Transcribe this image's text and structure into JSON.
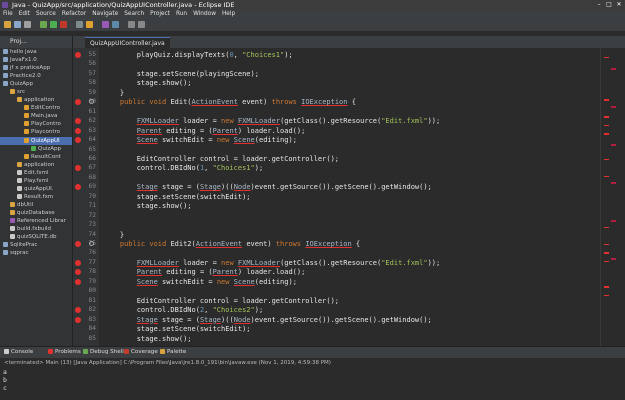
{
  "window": {
    "title": "Java - QuizApp/src/application/QuizAppUIController.java - Eclipse IDE"
  },
  "menu": [
    "File",
    "Edit",
    "Source",
    "Refactor",
    "Navigate",
    "Search",
    "Project",
    "Run",
    "Window",
    "Help"
  ],
  "sidebar": {
    "title": "Proj...",
    "items": [
      {
        "label": "hello java"
      },
      {
        "label": "JavaFx1.0"
      },
      {
        "label": "jf x praticeApp"
      },
      {
        "label": "Practice2.0"
      },
      {
        "label": "QuizApp"
      },
      {
        "label": "src"
      },
      {
        "label": "application"
      },
      {
        "label": "EditContro"
      },
      {
        "label": "Main.java"
      },
      {
        "label": "PlayContro"
      },
      {
        "label": "Playcontro"
      },
      {
        "label": "QuizAppUI"
      },
      {
        "label": "QuizApp"
      },
      {
        "label": "ResultCont"
      },
      {
        "label": "application"
      },
      {
        "label": "Edit.fxml"
      },
      {
        "label": "Play.fxml"
      },
      {
        "label": "quizAppUI."
      },
      {
        "label": "Result.fxm"
      },
      {
        "label": "dbUtil"
      },
      {
        "label": "quizDatabase"
      },
      {
        "label": "Referenced Librar"
      },
      {
        "label": "build.fxbuild"
      },
      {
        "label": "quizSQLITE.db"
      },
      {
        "label": "SqlitePrac"
      },
      {
        "label": "sqprac"
      }
    ]
  },
  "editor": {
    "tab": "QuizAppUIController.java",
    "lines": [
      {
        "n": "55",
        "text": "        playQuiz.displayTexts(0, \"Choices1\");",
        "err": true
      },
      {
        "n": "56",
        "text": ""
      },
      {
        "n": "57",
        "text": "        stage.setScene(playingScene);"
      },
      {
        "n": "58",
        "text": "        stage.show();"
      },
      {
        "n": "59",
        "text": "    }"
      },
      {
        "n": "60",
        "text": "    public void Edit(ActionEvent event) throws IOException {",
        "err": true,
        "circ": true
      },
      {
        "n": "61",
        "text": ""
      },
      {
        "n": "62",
        "text": "        FXMLLoader loader = new FXMLLoader(getClass().getResource(\"Edit.fxml\"));",
        "err": true
      },
      {
        "n": "63",
        "text": "        Parent editing = (Parent) loader.load();",
        "err": true
      },
      {
        "n": "64",
        "text": "        Scene switchEdit = new Scene(editing);",
        "err": true
      },
      {
        "n": "65",
        "text": ""
      },
      {
        "n": "66",
        "text": "        EditController control = loader.getController();"
      },
      {
        "n": "67",
        "text": "        control.DBIdNo(1, \"Choices1\");",
        "err": true
      },
      {
        "n": "68",
        "text": ""
      },
      {
        "n": "69",
        "text": "        Stage stage = (Stage)((Node)event.getSource()).getScene().getWindow();",
        "err": true
      },
      {
        "n": "70",
        "text": "        stage.setScene(switchEdit);"
      },
      {
        "n": "71",
        "text": "        stage.show();"
      },
      {
        "n": "72",
        "text": ""
      },
      {
        "n": "73",
        "text": ""
      },
      {
        "n": "74",
        "text": "    }"
      },
      {
        "n": "75",
        "text": "    public void Edit2(ActionEvent event) throws IOException {",
        "err": true,
        "circ": true
      },
      {
        "n": "76",
        "text": ""
      },
      {
        "n": "77",
        "text": "        FXMLLoader loader = new FXMLLoader(getClass().getResource(\"Edit.fxml\"));",
        "err": true
      },
      {
        "n": "78",
        "text": "        Parent editing = (Parent) loader.load();",
        "err": true
      },
      {
        "n": "79",
        "text": "        Scene switchEdit = new Scene(editing);",
        "err": true
      },
      {
        "n": "80",
        "text": ""
      },
      {
        "n": "81",
        "text": "        EditController control = loader.getController();"
      },
      {
        "n": "82",
        "text": "        control.DBIdNo(2, \"Choices2\");",
        "err": true
      },
      {
        "n": "83",
        "text": "        Stage stage = (Stage)((Node)event.getSource()).getScene().getWindow();",
        "err": true
      },
      {
        "n": "84",
        "text": "        stage.setScene(switchEdit);"
      },
      {
        "n": "85",
        "text": "        stage.show();"
      }
    ]
  },
  "bottom_tabs": [
    {
      "label": "Console"
    },
    {
      "label": "Problems"
    },
    {
      "label": "Debug Shell"
    },
    {
      "label": "Coverage"
    },
    {
      "label": "Palette"
    }
  ],
  "console": {
    "terminated": "<terminated> Main (13) [Java Application] C:\\Program Files\\Java\\jre1.8.0_191\\bin\\javaw.exe (Nov 1, 2019, 4:59:38 PM)",
    "lines": [
      "a",
      "b",
      "c"
    ]
  },
  "colors": {
    "accent": "#4b6eaf",
    "error": "#e03030",
    "keyword": "#cc7832",
    "string": "#a5c25c"
  }
}
